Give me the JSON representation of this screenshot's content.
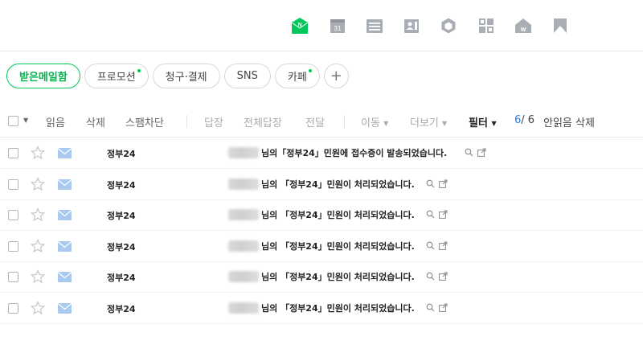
{
  "apps": [
    {
      "name": "mail",
      "badge": "N"
    },
    {
      "name": "calendar",
      "label": "31"
    },
    {
      "name": "memo"
    },
    {
      "name": "contacts"
    },
    {
      "name": "mybox"
    },
    {
      "name": "office"
    },
    {
      "name": "home",
      "label": "W"
    },
    {
      "name": "bookmark"
    }
  ],
  "tabs": [
    {
      "label": "받은메일함",
      "active": true,
      "new": false
    },
    {
      "label": "프로모션",
      "active": false,
      "new": true
    },
    {
      "label": "청구·결제",
      "active": false,
      "new": false
    },
    {
      "label": "SNS",
      "active": false,
      "new": false
    },
    {
      "label": "카페",
      "active": false,
      "new": true
    }
  ],
  "tab_add_label": "+",
  "toolbar": {
    "read": "읽음",
    "delete": "삭제",
    "block_spam": "스팸차단",
    "reply": "답장",
    "reply_all": "전체답장",
    "forward": "전달",
    "move": "이동",
    "more": "더보기",
    "filter": "필터",
    "count_current": "6",
    "count_total": "/ 6",
    "unread_delete": "안읽음 삭제"
  },
  "colors": {
    "accent": "#03c75a",
    "link_blue": "#2b7be4",
    "envelope": "#a9c9ee"
  },
  "mails": [
    {
      "sender": "정부24",
      "subject": "님의「정부24」민원에 접수증이 발송되었습니다."
    },
    {
      "sender": "정부24",
      "subject": "님의 「정부24」민원이 처리되었습니다."
    },
    {
      "sender": "정부24",
      "subject": "님의 「정부24」민원이 처리되었습니다."
    },
    {
      "sender": "정부24",
      "subject": "님의 「정부24」민원이 처리되었습니다."
    },
    {
      "sender": "정부24",
      "subject": "님의 「정부24」민원이 처리되었습니다."
    },
    {
      "sender": "정부24",
      "subject": "님의 「정부24」민원이 처리되었습니다."
    }
  ]
}
